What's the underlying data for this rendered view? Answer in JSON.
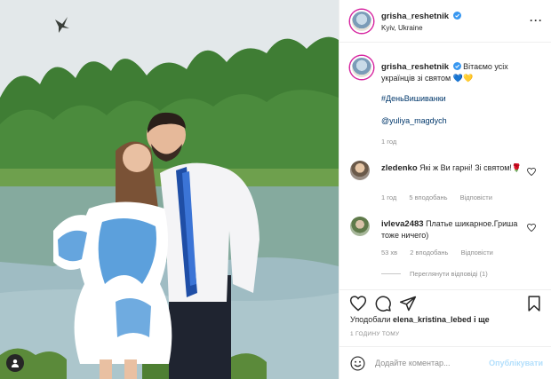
{
  "post": {
    "username": "grisha_reshetnik",
    "location": "Kyiv, Ukraine",
    "caption": "Вітаємо усіх українців зі святом 💙💛",
    "hashtag": "#ДеньВишиванки",
    "mention": "@yuliya_magdych",
    "caption_time": "1 год"
  },
  "comments": [
    {
      "username": "zledenko",
      "text": "Які ж Ви гарні! Зі святом!🌹",
      "time": "1 год",
      "likes": "5 вподобань",
      "reply": "Відповісти"
    },
    {
      "username": "ivleva2483",
      "text": "Платье шикарное.Гриша тоже ничего)",
      "time": "53 хв",
      "likes": "2 вподобань",
      "reply": "Відповісти",
      "view_replies": "Переглянути відповіді (1)"
    }
  ],
  "likes": {
    "prefix": "Уподобали",
    "user": "elena_kristina_lebed",
    "suffix": "і ще"
  },
  "posted_ago": "1 ГОДИНУ ТОМУ",
  "comment_input": {
    "placeholder": "Додайте коментар..."
  },
  "publish_label": "Опублікувати",
  "colors": {
    "link": "#00376b",
    "muted": "#8e8e8e",
    "publish_disabled": "#b2dffc",
    "verified": "#3897f0"
  },
  "icons": [
    "more-icon",
    "heart-icon",
    "comment-icon",
    "share-icon",
    "bookmark-icon",
    "emoji-icon",
    "verified-icon",
    "user-tag-icon"
  ]
}
